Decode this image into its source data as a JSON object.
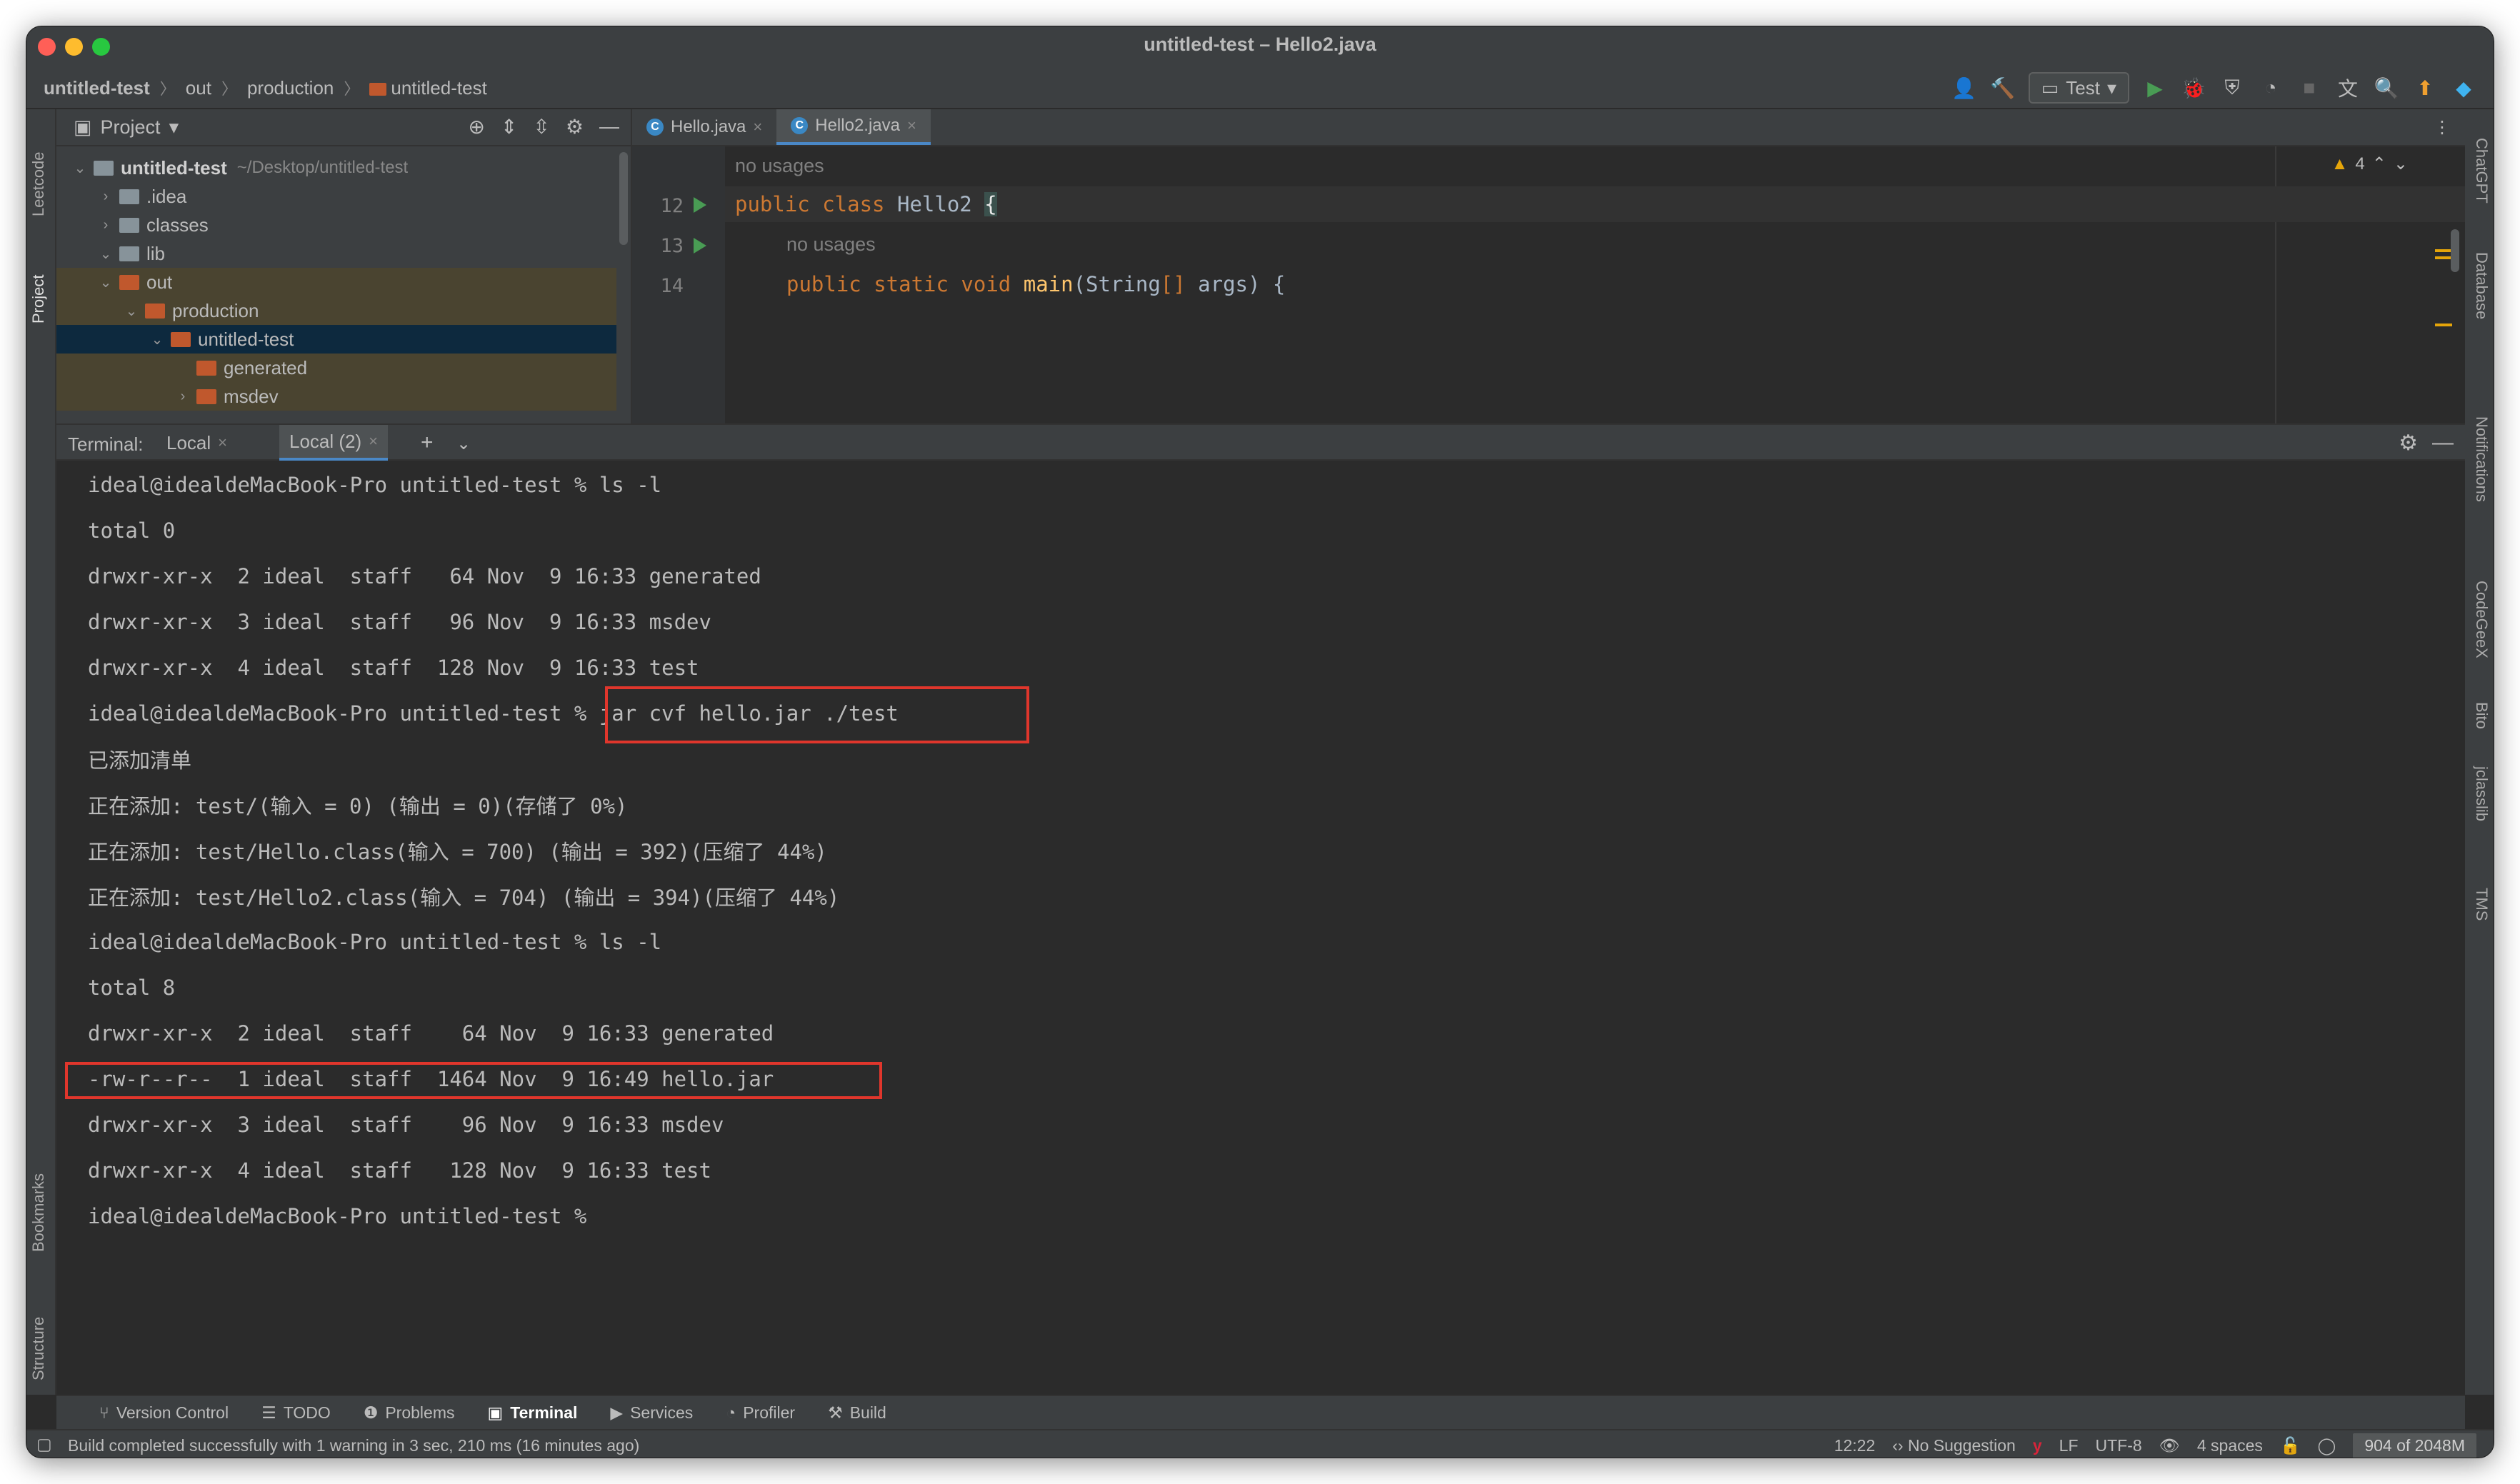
{
  "window": {
    "title": "untitled-test – Hello2.java"
  },
  "breadcrumb": {
    "items": [
      "untitled-test",
      "out",
      "production",
      "untitled-test"
    ]
  },
  "toolbar": {
    "run_config": "Test"
  },
  "left_strip": {
    "labels": [
      "Leetcode",
      "Project",
      "Bookmarks",
      "Structure"
    ]
  },
  "right_strip": {
    "labels": [
      "ChatGPT",
      "Database",
      "Notifications",
      "CodeGeeX",
      "Bito",
      "jclasslib",
      "TMS"
    ]
  },
  "project": {
    "header": "Project",
    "root": {
      "name": "untitled-test",
      "path": "~/Desktop/untitled-test"
    },
    "items": [
      ".idea",
      "classes",
      "lib",
      "out",
      "production",
      "untitled-test",
      "generated",
      "msdev"
    ]
  },
  "editor": {
    "tabs": [
      "Hello.java",
      "Hello2.java"
    ],
    "warnings": "4",
    "hint_1": "no usages",
    "hint_2": "no usages",
    "line_numbers": [
      "12",
      "13",
      "14"
    ],
    "line12": {
      "kw": "public class ",
      "name": "Hello2 ",
      "brace": "{"
    },
    "line13": {
      "kw1": "public static void ",
      "fn": "main",
      "rest1": "(String",
      "arr": "[]",
      "rest2": " args) {"
    }
  },
  "terminal": {
    "label": "Terminal:",
    "tabs": [
      "Local",
      "Local (2)"
    ],
    "lines": [
      "ideal@idealdeMacBook-Pro untitled-test % ls -l",
      "total 0",
      "drwxr-xr-x  2 ideal  staff   64 Nov  9 16:33 generated",
      "drwxr-xr-x  3 ideal  staff   96 Nov  9 16:33 msdev",
      "drwxr-xr-x  4 ideal  staff  128 Nov  9 16:33 test",
      "ideal@idealdeMacBook-Pro untitled-test % jar cvf hello.jar ./test",
      "已添加清单",
      "正在添加: test/(输入 = 0) (输出 = 0)(存储了 0%)",
      "正在添加: test/Hello.class(输入 = 700) (输出 = 392)(压缩了 44%)",
      "正在添加: test/Hello2.class(输入 = 704) (输出 = 394)(压缩了 44%)",
      "ideal@idealdeMacBook-Pro untitled-test % ls -l",
      "total 8",
      "drwxr-xr-x  2 ideal  staff    64 Nov  9 16:33 generated",
      "-rw-r--r--  1 ideal  staff  1464 Nov  9 16:49 hello.jar",
      "drwxr-xr-x  3 ideal  staff    96 Nov  9 16:33 msdev",
      "drwxr-xr-x  4 ideal  staff   128 Nov  9 16:33 test",
      "ideal@idealdeMacBook-Pro untitled-test %"
    ],
    "highlight_color": "#e0362c"
  },
  "bottom_tools": [
    "Version Control",
    "TODO",
    "Problems",
    "Terminal",
    "Services",
    "Profiler",
    "Build"
  ],
  "status": {
    "message": "Build completed successfully with 1 warning in 3 sec, 210 ms (16 minutes ago)",
    "position": "12:22",
    "suggestion": "No Suggestion",
    "line_sep": "LF",
    "encoding": "UTF-8",
    "indent": "4 spaces",
    "memory": "904 of 2048M"
  },
  "colors": {
    "accent": "#4a88c7",
    "keyword": "#cc7832",
    "method": "#ffc66d",
    "run": "#499c54",
    "folder_excluded": "#c0582d"
  }
}
